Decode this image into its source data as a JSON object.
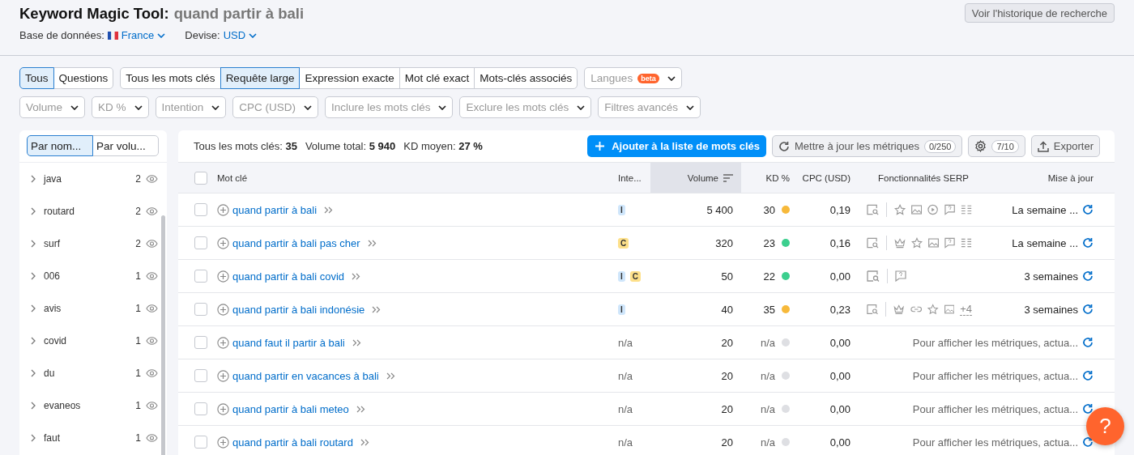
{
  "header": {
    "title": "Keyword Magic Tool:",
    "query": "quand partir à bali",
    "history_button": "Voir l'historique de recherche",
    "database_label": "Base de données:",
    "database_value": "France",
    "currency_label": "Devise:",
    "currency_value": "USD"
  },
  "mode_tabs": [
    {
      "label": "Tous",
      "selected": true
    },
    {
      "label": "Questions",
      "selected": false
    }
  ],
  "match_tabs": [
    {
      "label": "Tous les mots clés",
      "selected": false
    },
    {
      "label": "Requête large",
      "selected": true
    },
    {
      "label": "Expression exacte",
      "selected": false
    },
    {
      "label": "Mot clé exact",
      "selected": false
    },
    {
      "label": "Mots-clés associés",
      "selected": false
    }
  ],
  "languages": {
    "label": "Langues",
    "badge": "beta"
  },
  "filters": [
    "Volume",
    "KD %",
    "Intention",
    "CPC (USD)",
    "Inclure les mots clés",
    "Exclure les mots clés",
    "Filtres avancés"
  ],
  "sidebar": {
    "toggles": [
      {
        "label": "Par nom...",
        "selected": true
      },
      {
        "label": "Par volu...",
        "selected": false
      }
    ],
    "groups": [
      {
        "name": "java",
        "count": "2"
      },
      {
        "name": "routard",
        "count": "2"
      },
      {
        "name": "surf",
        "count": "2"
      },
      {
        "name": "006",
        "count": "1"
      },
      {
        "name": "avis",
        "count": "1"
      },
      {
        "name": "covid",
        "count": "1"
      },
      {
        "name": "du",
        "count": "1"
      },
      {
        "name": "evaneos",
        "count": "1"
      },
      {
        "name": "faut",
        "count": "1"
      }
    ]
  },
  "summary": {
    "all_label": "Tous les mots clés:",
    "all_value": "35",
    "volume_label": "Volume total:",
    "volume_value": "5 940",
    "kd_label": "KD moyen:",
    "kd_value": "27 %"
  },
  "toolbar": {
    "add_button": "Ajouter à la liste de mots clés",
    "update_button": "Mettre à jour les métriques",
    "update_count": "0/250",
    "settings_count": "7/10",
    "export_button": "Exporter"
  },
  "table": {
    "all_checked": false,
    "columns": [
      "Mot clé",
      "Inte...",
      "Volume",
      "KD %",
      "CPC (USD)",
      "Fonctionnalités SERP",
      "Mise à jour"
    ],
    "rows": [
      {
        "checked": false,
        "keyword": "quand partir à bali",
        "intents": [
          {
            "label": "I",
            "color": "#cfe6fb"
          }
        ],
        "volume": "5 400",
        "kd": "30",
        "color": "#f7b93a",
        "cpc": "0,19",
        "serp": [
          {
            "kind": "page"
          },
          {
            "kind": "star"
          },
          {
            "kind": "image"
          },
          {
            "kind": "video"
          },
          {
            "kind": "faq"
          },
          {
            "kind": "list"
          }
        ],
        "updated": "La semaine ...",
        "kind": "date"
      },
      {
        "checked": false,
        "keyword": "quand partir à bali pas cher",
        "intents": [
          {
            "label": "C",
            "color": "#fde08a"
          }
        ],
        "volume": "320",
        "kd": "23",
        "color": "#3ccf8e",
        "cpc": "0,16",
        "serp": [
          {
            "kind": "page"
          },
          {
            "kind": "crown"
          },
          {
            "kind": "star"
          },
          {
            "kind": "image"
          },
          {
            "kind": "faq"
          },
          {
            "kind": "list"
          }
        ],
        "updated": "La semaine ...",
        "kind": "date"
      },
      {
        "checked": false,
        "keyword": "quand partir à bali covid",
        "intents": [
          {
            "label": "I",
            "color": "#cfe6fb"
          },
          {
            "label": "C",
            "color": "#fde08a"
          }
        ],
        "volume": "50",
        "kd": "22",
        "color": "#3ccf8e",
        "cpc": "0,00",
        "serp": [
          {
            "kind": "page"
          },
          {
            "kind": "faq"
          }
        ],
        "updated": "3 semaines",
        "kind": "date"
      },
      {
        "checked": false,
        "keyword": "quand partir à bali indonésie",
        "intents": [
          {
            "label": "I",
            "color": "#cfe6fb"
          }
        ],
        "volume": "40",
        "kd": "35",
        "color": "#f7b93a",
        "cpc": "0,23",
        "serp": [
          {
            "kind": "page"
          },
          {
            "kind": "crown"
          },
          {
            "kind": "link"
          },
          {
            "kind": "star"
          },
          {
            "kind": "image"
          },
          {
            "kind": "more",
            "label": "+4"
          }
        ],
        "updated": "3 semaines",
        "kind": "date"
      },
      {
        "checked": false,
        "keyword": "quand faut il partir à bali",
        "intent_text": "n/a",
        "volume": "20",
        "kd": "n/a",
        "color": "#dedfe3",
        "cpc": "0,00",
        "updated": "Pour afficher les métriques, actua...",
        "kind": "hint"
      },
      {
        "checked": false,
        "keyword": "quand partir en vacances à bali",
        "intent_text": "n/a",
        "volume": "20",
        "kd": "n/a",
        "color": "#dedfe3",
        "cpc": "0,00",
        "updated": "Pour afficher les métriques, actua...",
        "kind": "hint"
      },
      {
        "checked": false,
        "keyword": "quand partir à bali meteo",
        "intent_text": "n/a",
        "volume": "20",
        "kd": "n/a",
        "color": "#dedfe3",
        "cpc": "0,00",
        "updated": "Pour afficher les métriques, actua...",
        "kind": "hint"
      },
      {
        "checked": false,
        "keyword": "quand partir à bali routard",
        "intent_text": "n/a",
        "volume": "20",
        "kd": "n/a",
        "color": "#dedfe3",
        "cpc": "0,00",
        "updated": "Pour afficher les métriques, actua...",
        "kind": "hint"
      }
    ]
  },
  "help_button": "?"
}
